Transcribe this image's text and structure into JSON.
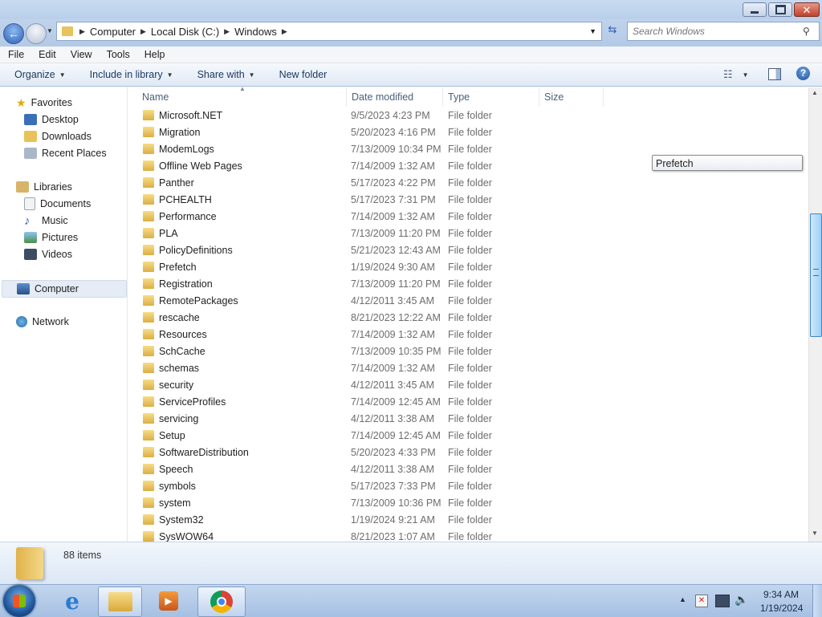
{
  "window": {
    "caption_buttons": {
      "minimize": "minimize-icon",
      "maximize": "restore-icon",
      "close": "close-icon"
    }
  },
  "address": {
    "crumbs": [
      "Computer",
      "Local Disk (C:)",
      "Windows"
    ],
    "search_placeholder": "Search Windows"
  },
  "menubar": [
    "File",
    "Edit",
    "View",
    "Tools",
    "Help"
  ],
  "toolbar": {
    "organize": "Organize",
    "include_in_library": "Include in library",
    "share_with": "Share with",
    "new_folder": "New folder"
  },
  "navpane": {
    "favorites": {
      "label": "Favorites",
      "items": [
        "Desktop",
        "Downloads",
        "Recent Places"
      ]
    },
    "libraries": {
      "label": "Libraries",
      "items": [
        "Documents",
        "Music",
        "Pictures",
        "Videos"
      ]
    },
    "computer": "Computer",
    "network": "Network"
  },
  "columns": [
    "Name",
    "Date modified",
    "Type",
    "Size"
  ],
  "files": [
    {
      "name": "Microsoft.NET",
      "date": "9/5/2023 4:23 PM",
      "type": "File folder"
    },
    {
      "name": "Migration",
      "date": "5/20/2023 4:16 PM",
      "type": "File folder"
    },
    {
      "name": "ModemLogs",
      "date": "7/13/2009 10:34 PM",
      "type": "File folder"
    },
    {
      "name": "Offline Web Pages",
      "date": "7/14/2009 1:32 AM",
      "type": "File folder"
    },
    {
      "name": "Panther",
      "date": "5/17/2023 4:22 PM",
      "type": "File folder"
    },
    {
      "name": "PCHEALTH",
      "date": "5/17/2023 7:31 PM",
      "type": "File folder"
    },
    {
      "name": "Performance",
      "date": "7/14/2009 1:32 AM",
      "type": "File folder"
    },
    {
      "name": "PLA",
      "date": "7/13/2009 11:20 PM",
      "type": "File folder"
    },
    {
      "name": "PolicyDefinitions",
      "date": "5/21/2023 12:43 AM",
      "type": "File folder"
    },
    {
      "name": "Prefetch",
      "date": "1/19/2024 9:30 AM",
      "type": "File folder"
    },
    {
      "name": "Registration",
      "date": "7/13/2009 11:20 PM",
      "type": "File folder"
    },
    {
      "name": "RemotePackages",
      "date": "4/12/2011 3:45 AM",
      "type": "File folder"
    },
    {
      "name": "rescache",
      "date": "8/21/2023 12:22 AM",
      "type": "File folder"
    },
    {
      "name": "Resources",
      "date": "7/14/2009 1:32 AM",
      "type": "File folder"
    },
    {
      "name": "SchCache",
      "date": "7/13/2009 10:35 PM",
      "type": "File folder"
    },
    {
      "name": "schemas",
      "date": "7/14/2009 1:32 AM",
      "type": "File folder"
    },
    {
      "name": "security",
      "date": "4/12/2011 3:45 AM",
      "type": "File folder"
    },
    {
      "name": "ServiceProfiles",
      "date": "7/14/2009 12:45 AM",
      "type": "File folder"
    },
    {
      "name": "servicing",
      "date": "4/12/2011 3:38 AM",
      "type": "File folder"
    },
    {
      "name": "Setup",
      "date": "7/14/2009 12:45 AM",
      "type": "File folder"
    },
    {
      "name": "SoftwareDistribution",
      "date": "5/20/2023 4:33 PM",
      "type": "File folder"
    },
    {
      "name": "Speech",
      "date": "4/12/2011 3:38 AM",
      "type": "File folder"
    },
    {
      "name": "symbols",
      "date": "5/17/2023 7:33 PM",
      "type": "File folder"
    },
    {
      "name": "system",
      "date": "7/13/2009 10:36 PM",
      "type": "File folder"
    },
    {
      "name": "System32",
      "date": "1/19/2024 9:21 AM",
      "type": "File folder"
    },
    {
      "name": "SysWOW64",
      "date": "8/21/2023 1:07 AM",
      "type": "File folder"
    }
  ],
  "tooltip": "Prefetch",
  "status": {
    "item_count": "88 items"
  },
  "taskbar": {
    "time": "9:34 AM",
    "date": "1/19/2024",
    "apps": [
      "internet-explorer-icon",
      "windows-explorer-icon",
      "media-player-icon",
      "chrome-icon"
    ]
  },
  "colors": {
    "folder": "#e8c25a",
    "selected_nav": "#e5ecf6",
    "accent": "#3a6fb8"
  }
}
